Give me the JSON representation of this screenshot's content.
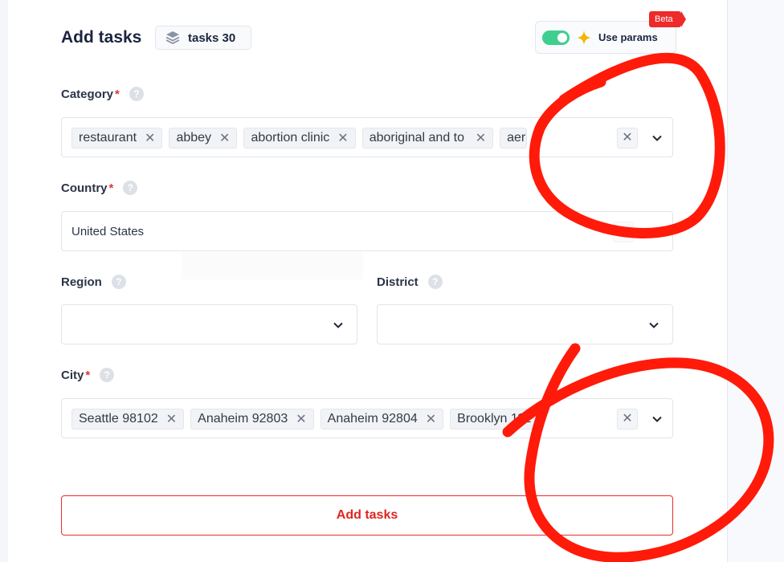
{
  "header": {
    "title": "Add tasks",
    "tasks_badge": "tasks 30",
    "use_params_label": "Use params",
    "use_params_on": true,
    "beta_label": "Beta"
  },
  "fields": {
    "category": {
      "label": "Category",
      "required": "*",
      "chips": [
        "restaurant",
        "abbey",
        "abortion clinic",
        "aboriginal and to",
        "aero"
      ]
    },
    "country": {
      "label": "Country",
      "required": "*",
      "value": "United States"
    },
    "region": {
      "label": "Region",
      "value": ""
    },
    "district": {
      "label": "District",
      "value": ""
    },
    "city": {
      "label": "City",
      "required": "*",
      "chips": [
        "Seattle 98102",
        "Anaheim 92803",
        "Anaheim 92804",
        "Brooklyn 112"
      ]
    }
  },
  "actions": {
    "submit_label": "Add tasks"
  },
  "icons": {
    "help": "?",
    "remove": "✕",
    "clear": "✕",
    "layers": "layers-icon",
    "sparkle": "sparkle-icon",
    "chevron": "chevron-down-icon"
  },
  "colors": {
    "accent": "#ee2a2a",
    "toggle_on": "#3ecf8e",
    "sparkle": "#f5b400",
    "annotation": "#ff1a0a"
  }
}
